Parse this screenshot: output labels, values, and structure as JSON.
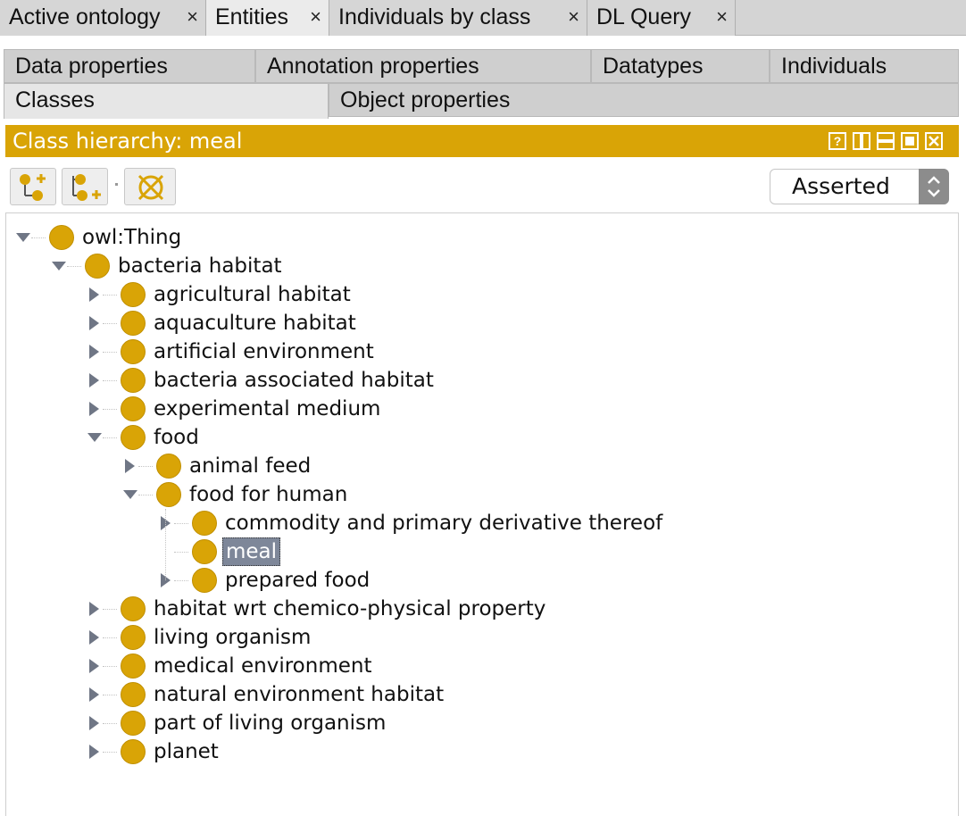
{
  "top_tabs": [
    {
      "label": "Active ontology",
      "close": "×"
    },
    {
      "label": "Entities",
      "close": "×"
    },
    {
      "label": "Individuals by class",
      "close": "×"
    },
    {
      "label": "DL Query",
      "close": "×"
    }
  ],
  "entity_tabs": {
    "data_properties": "Data properties",
    "annotation_properties": "Annotation properties",
    "datatypes": "Datatypes",
    "individuals": "Individuals",
    "classes": "Classes",
    "object_properties": "Object properties"
  },
  "view": {
    "title": "Class hierarchy: meal",
    "accent": "#d9a406"
  },
  "toolbar": {
    "add_subclass_icon": "add-subclass-icon",
    "add_sibling_icon": "add-sibling-icon",
    "delete_icon": "delete-class-icon",
    "reasoner_mode": "Asserted"
  },
  "tree": [
    {
      "label": "owl:Thing",
      "depth": 0,
      "toggle": "expanded"
    },
    {
      "label": "bacteria habitat",
      "depth": 1,
      "toggle": "expanded"
    },
    {
      "label": "agricultural habitat",
      "depth": 2,
      "toggle": "collapsed"
    },
    {
      "label": "aquaculture habitat",
      "depth": 2,
      "toggle": "collapsed"
    },
    {
      "label": "artificial environment",
      "depth": 2,
      "toggle": "collapsed"
    },
    {
      "label": "bacteria associated habitat",
      "depth": 2,
      "toggle": "collapsed"
    },
    {
      "label": "experimental medium",
      "depth": 2,
      "toggle": "collapsed"
    },
    {
      "label": "food",
      "depth": 2,
      "toggle": "expanded"
    },
    {
      "label": "animal feed",
      "depth": 3,
      "toggle": "collapsed"
    },
    {
      "label": "food for human",
      "depth": 3,
      "toggle": "expanded"
    },
    {
      "label": "commodity and primary derivative thereof",
      "depth": 4,
      "toggle": "collapsed"
    },
    {
      "label": "meal",
      "depth": 4,
      "toggle": "none",
      "selected": true
    },
    {
      "label": "prepared food",
      "depth": 4,
      "toggle": "collapsed"
    },
    {
      "label": "habitat wrt chemico-physical property",
      "depth": 2,
      "toggle": "collapsed"
    },
    {
      "label": "living organism",
      "depth": 2,
      "toggle": "collapsed"
    },
    {
      "label": "medical environment",
      "depth": 2,
      "toggle": "collapsed"
    },
    {
      "label": "natural environment habitat",
      "depth": 2,
      "toggle": "collapsed"
    },
    {
      "label": "part of living organism",
      "depth": 2,
      "toggle": "collapsed"
    },
    {
      "label": "planet",
      "depth": 2,
      "toggle": "collapsed"
    }
  ]
}
